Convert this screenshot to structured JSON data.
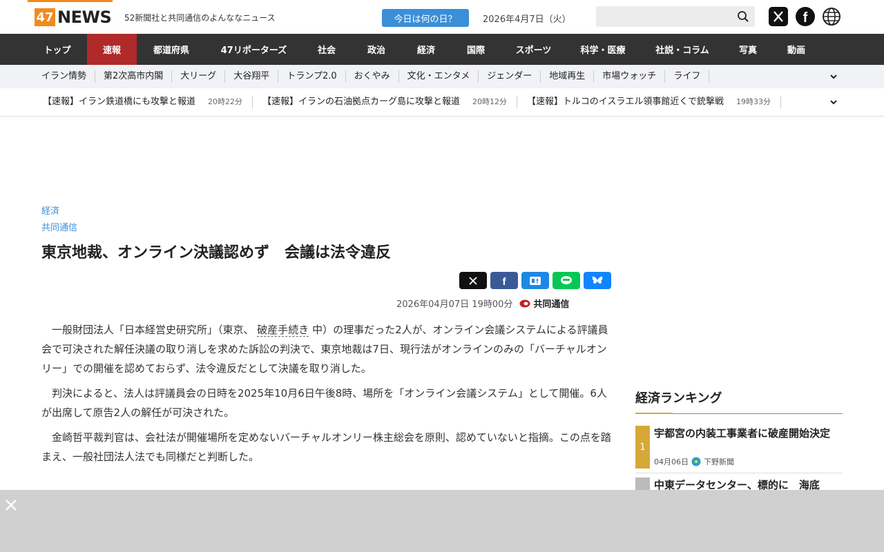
{
  "header": {
    "logo_num": "47",
    "logo_text": "NEWS",
    "tagline": "52新聞社と共同通信のよんななニュース",
    "today_button": "今日は何の日？",
    "date": "2026年4月7日（火）"
  },
  "nav": {
    "items": [
      "トップ",
      "速報",
      "都道府県",
      "47リポーターズ",
      "社会",
      "政治",
      "経済",
      "国際",
      "スポーツ",
      "科学・医療",
      "社説・コラム",
      "写真",
      "動画"
    ]
  },
  "subnav": {
    "items": [
      "イラン情勢",
      "第2次高市内閣",
      "大リーグ",
      "大谷翔平",
      "トランプ2.0",
      "おくやみ",
      "文化・エンタメ",
      "ジェンダー",
      "地域再生",
      "市場ウォッチ",
      "ライフ"
    ]
  },
  "breaking": {
    "items": [
      {
        "title": "【速報】イラン鉄道橋にも攻撃と報道",
        "time": "20時22分"
      },
      {
        "title": "【速報】イランの石油拠点カーグ島に攻撃と報道",
        "time": "20時12分"
      },
      {
        "title": "【速報】トルコのイスラエル領事館近くで銃撃戦",
        "time": "19時33分"
      }
    ]
  },
  "article": {
    "category": "経済",
    "source": "共同通信",
    "title": "東京地裁、オンライン決議認めず　会議は法令違反",
    "pubdate": "2026年04月07日 19時00分",
    "pub_source": "共同通信",
    "p1_a": "一般財団法人「日本経営史研究所」（東京、",
    "p1_keyword": "破産手続き",
    "p1_b": "中）の理事だった2人が、オンライン会議システムによる評議員会で可決された解任決議の取り消しを求めた訴訟の判決で、東京地裁は7日、現行法がオンラインのみの「バーチャルオンリー」での開催を認めておらず、法令違反だとして決議を取り消した。",
    "p2": "判決によると、法人は評議員会の日時を2025年10月6日午後8時、場所を「オンライン会議システム」として開催。6人が出席して原告2人の解任が可決された。",
    "p3": "金崎哲平裁判官は、会社法が開催場所を定めないバーチャルオンリー株主総会を原則、認めていないと指摘。この点を踏まえ、一般社団法人法でも同様だと判断した。"
  },
  "ranking": {
    "heading": "経済ランキング",
    "items": [
      {
        "rank": "1",
        "title": "宇都宮の内装工事業者に破産開始決定",
        "date": "04月06日",
        "paper": "下野新聞"
      },
      {
        "rank": "2",
        "title": "中東データセンター、標的に　海底",
        "date": "",
        "paper": ""
      }
    ]
  },
  "colors": {
    "accent": "#f08a1c",
    "nav_bg": "#333333",
    "nav_active": "#b02a2a",
    "link": "#3a8fd8",
    "rank_gold": "#d6a838"
  }
}
